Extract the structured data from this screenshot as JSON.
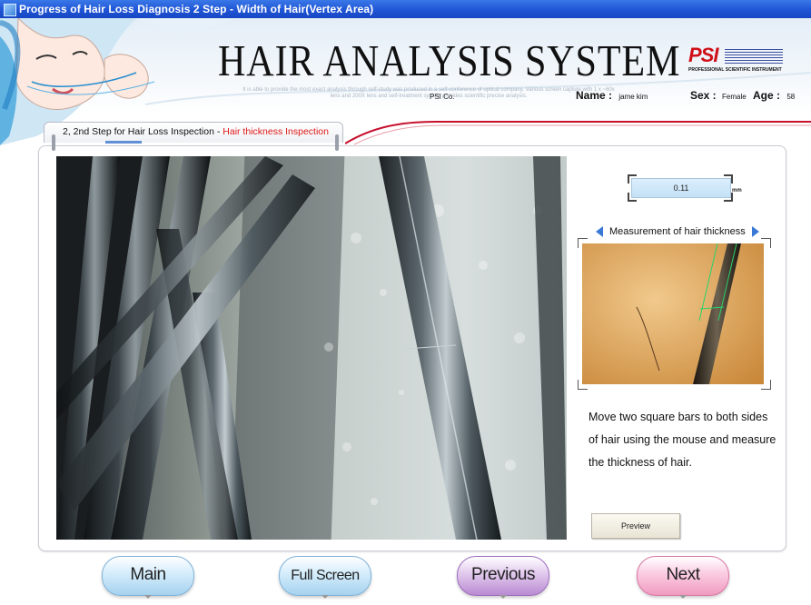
{
  "window": {
    "title": "Progress of Hair Loss Diagnosis 2 Step - Width of Hair(Vertex Area)",
    "icon": "app-window-icon"
  },
  "header": {
    "system_title": "HAIR ANALYSIS SYSTEM",
    "subtitle": "It is able to provide the most exact analysis through self-study was produced in a self-conference of optical company. Various screen capture with 1 x ~60x lens and 200X lens and self-treatment system provides scientific precise analysis.",
    "logo_text": "PSI",
    "logo_tagline": "PROFESSIONAL SCIENTIFIC INSTRUMENT",
    "company": "PSI Co.",
    "name_label": "Name :",
    "name_value": "jame kim",
    "sex_label": "Sex :",
    "sex_value": "Female",
    "age_label": "Age :",
    "age_value": "58"
  },
  "step_tab": {
    "prefix": "2, 2nd Step for Hair Loss Inspection - ",
    "highlight": "Hair thickness Inspection",
    "highlight_color": "#e01818"
  },
  "measurement": {
    "value": "0.11",
    "unit": "mm",
    "heading": "Measurement of hair thickness",
    "instruction": "Move two square bars to both sides of hair using the mouse and measure the thickness of hair.",
    "preview_label": "Preview"
  },
  "nav": {
    "main": "Main",
    "full_screen": "Full Screen",
    "previous": "Previous",
    "next": "Next"
  },
  "colors": {
    "titlebar": "#1f55d6",
    "accent_red": "#c8102e",
    "value_box": "#c4e1f6",
    "nav_blue": "#a5d2ef",
    "nav_purple": "#b98bd2",
    "nav_pink": "#f09ac0"
  }
}
